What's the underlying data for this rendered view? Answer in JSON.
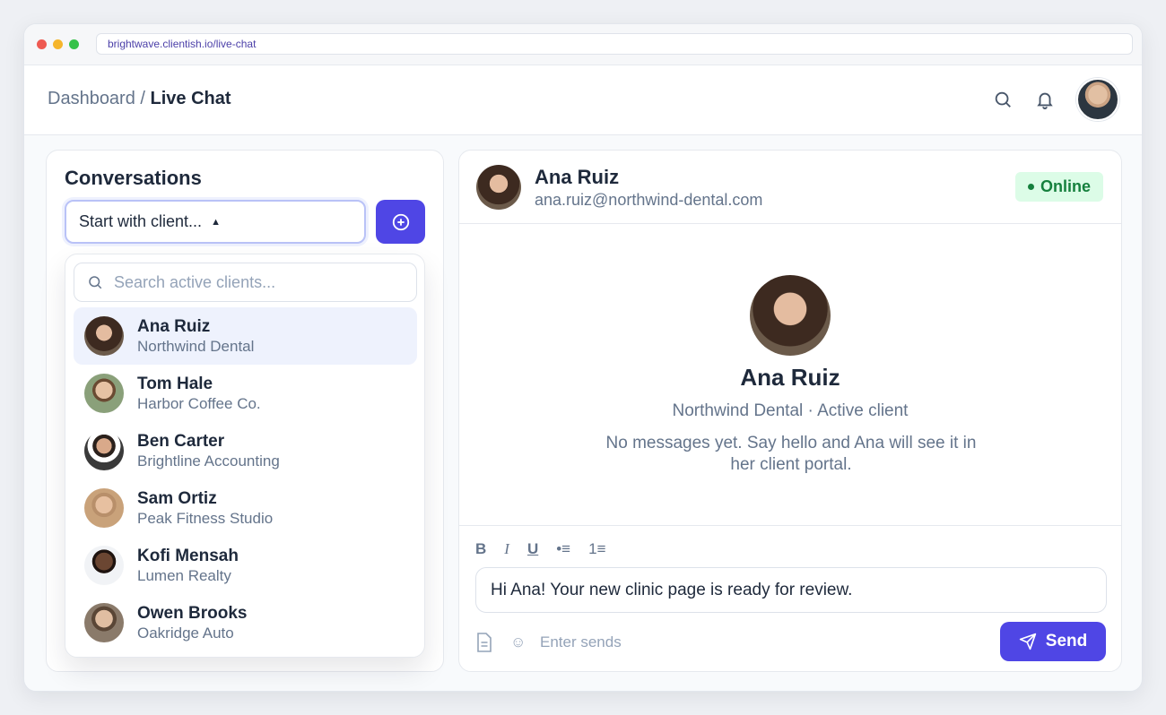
{
  "browser": {
    "url": "brightwave.clientish.io/live-chat"
  },
  "header": {
    "breadcrumb_parent": "Dashboard",
    "breadcrumb_separator": " / ",
    "breadcrumb_current": "Live Chat",
    "icons": [
      "search-icon",
      "bell-icon",
      "user-avatar"
    ]
  },
  "conversations": {
    "title": "Conversations",
    "select_value": "Start with client...",
    "add_icon": "plus-circle-icon",
    "search_placeholder": "Search active clients...",
    "clients": [
      {
        "name": "Ana Ruiz",
        "company": "Northwind Dental",
        "selected": true,
        "avatar_color": "#6b5a4a"
      },
      {
        "name": "Tom Hale",
        "company": "Harbor Coffee Co.",
        "selected": false,
        "avatar_color": "#8aa07a"
      },
      {
        "name": "Ben Carter",
        "company": "Brightline Accounting",
        "selected": false,
        "avatar_color": "#3a3a3a"
      },
      {
        "name": "Sam Ortiz",
        "company": "Peak Fitness Studio",
        "selected": false,
        "avatar_color": "#c9a27a"
      },
      {
        "name": "Kofi Mensah",
        "company": "Lumen Realty",
        "selected": false,
        "avatar_color": "#4a3226"
      },
      {
        "name": "Owen Brooks",
        "company": "Oakridge Auto",
        "selected": false,
        "avatar_color": "#8a7a6a"
      }
    ]
  },
  "chat": {
    "name": "Ana Ruiz",
    "email": "ana.ruiz@northwind-dental.com",
    "status": "Online",
    "empty_name": "Ana Ruiz",
    "empty_subtitle": "Northwind Dental · Active client",
    "empty_message": "No messages yet. Say hello and Ana will see it in her client portal.",
    "format_buttons": [
      "B",
      "I",
      "U",
      "•≡",
      "1≡"
    ],
    "message_value": "Hi Ana! Your new clinic page is ready for review.",
    "hint": "Enter sends",
    "emoji_glyph": "☺",
    "send_label": "Send"
  },
  "colors": {
    "accent": "#4f46e5",
    "online_bg": "#dcfce7",
    "online_text": "#15803d"
  }
}
